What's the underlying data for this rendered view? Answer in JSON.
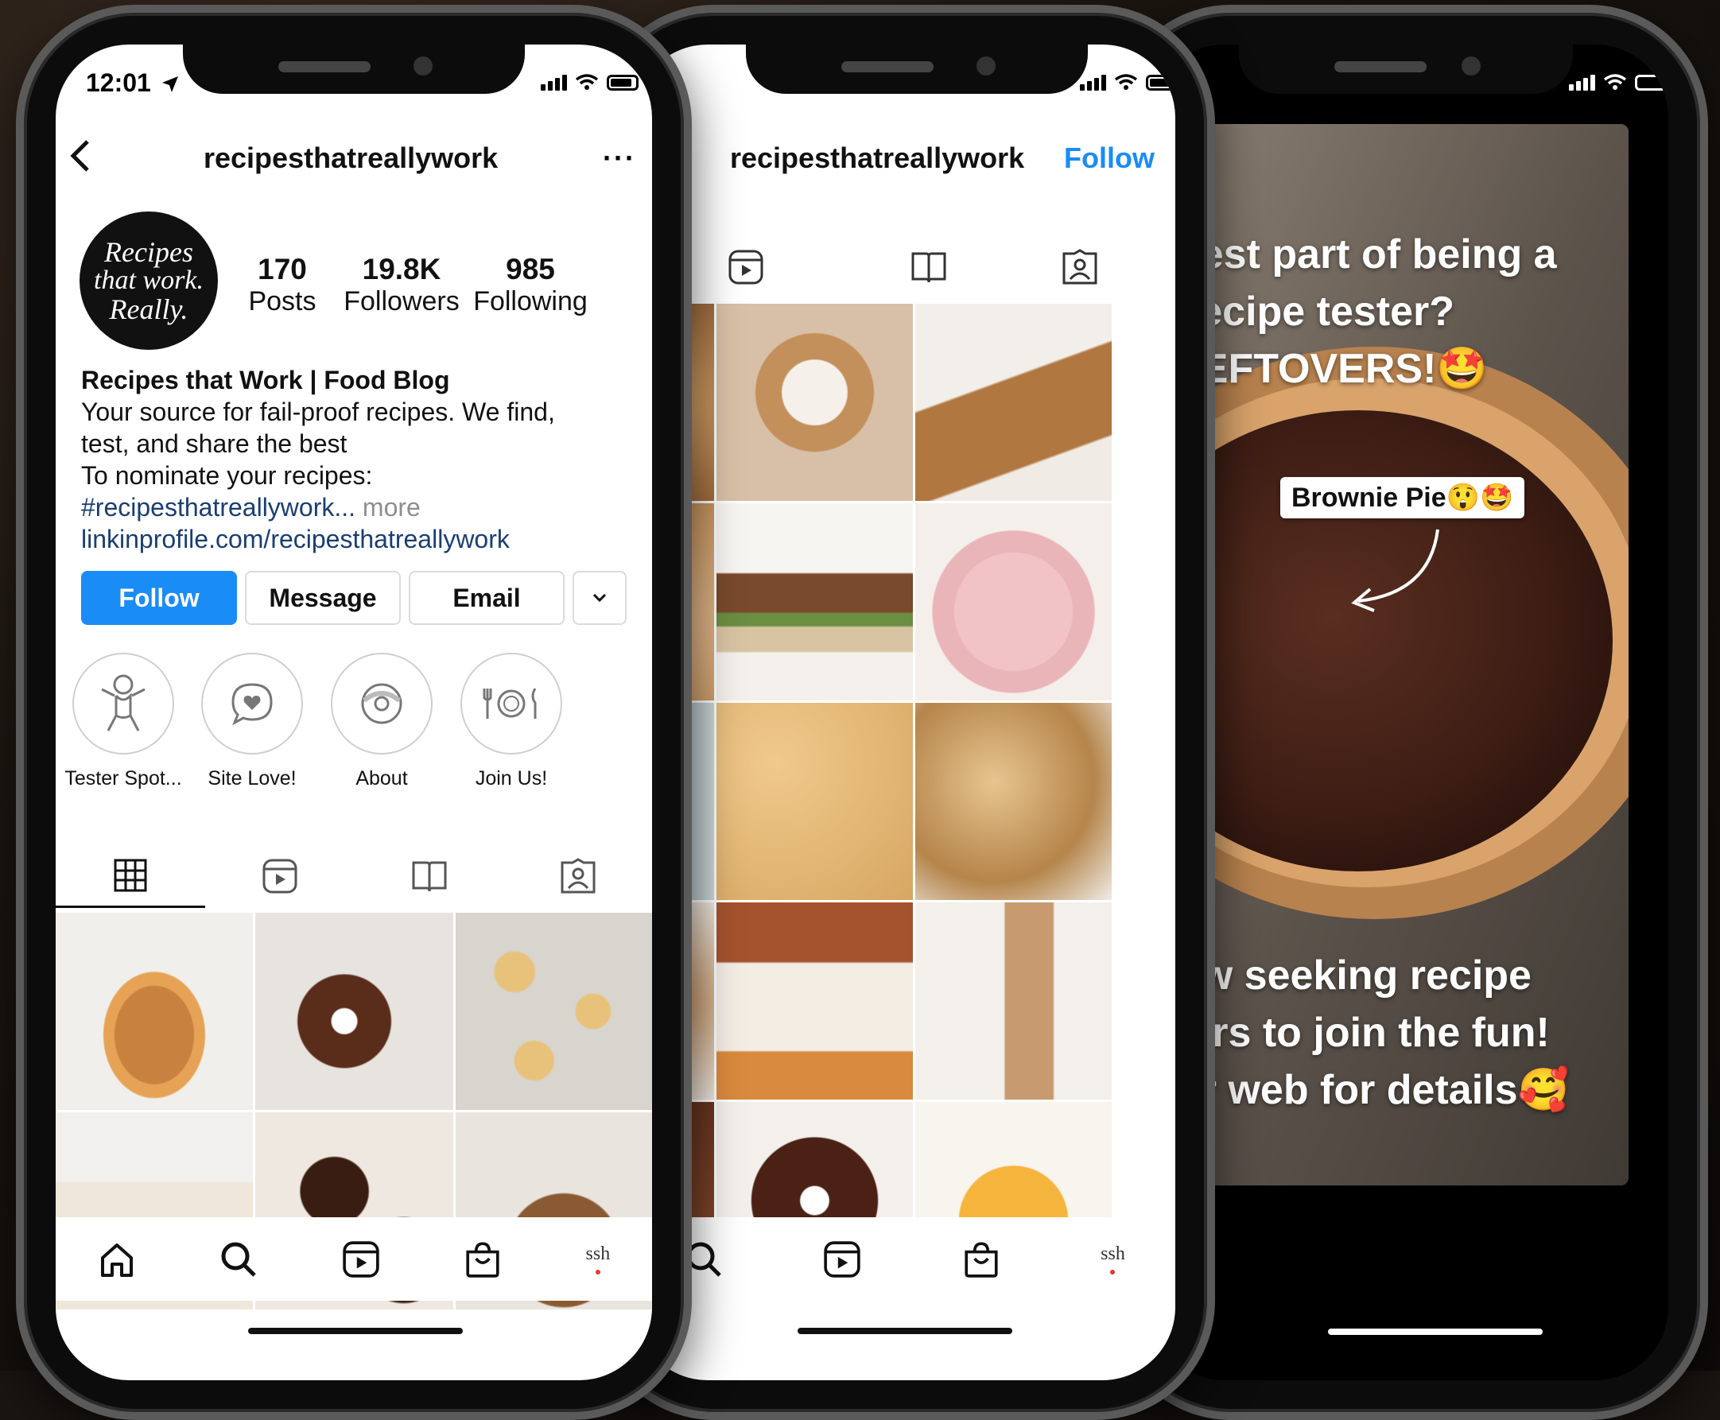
{
  "phone1": {
    "status": {
      "time": "12:01"
    },
    "header": {
      "username": "recipesthatreallywork"
    },
    "avatar": {
      "text_line1": "Recipes",
      "text_line2": "that work.",
      "text_line3": "Really."
    },
    "stats": [
      {
        "value": "170",
        "label": "Posts"
      },
      {
        "value": "19.8K",
        "label": "Followers"
      },
      {
        "value": "985",
        "label": "Following"
      }
    ],
    "bio": {
      "name": "Recipes that Work | Food Blog",
      "line1": "Your source for fail-proof recipes. We find,",
      "line2": "test, and share the best",
      "line3": "To nominate your recipes:",
      "hashtag": "#recipesthatreallywork...",
      "more": "more",
      "link": "linkinprofile.com/recipesthatreallywork"
    },
    "buttons": {
      "follow": "Follow",
      "message": "Message",
      "email": "Email"
    },
    "highlights": [
      {
        "label": "Tester Spot..."
      },
      {
        "label": "Site Love!"
      },
      {
        "label": "About"
      },
      {
        "label": "Join Us!"
      }
    ],
    "nav_profile": "ssh"
  },
  "phone2": {
    "header": {
      "username": "recipesthatreallywork",
      "follow": "Follow"
    },
    "nav_profile": "ssh"
  },
  "phone3": {
    "story": {
      "line1": "best part of being a",
      "line2": "recipe tester?",
      "line3": "LEFTOVERS!🤩",
      "sticker": "Brownie Pie😲🤩",
      "line4": "ow seeking recipe",
      "line5": "ters to join the fun!",
      "line6": "or web for details🥰"
    }
  },
  "colors": {
    "accent": "#1a8cf5",
    "link": "#1a3e72"
  }
}
